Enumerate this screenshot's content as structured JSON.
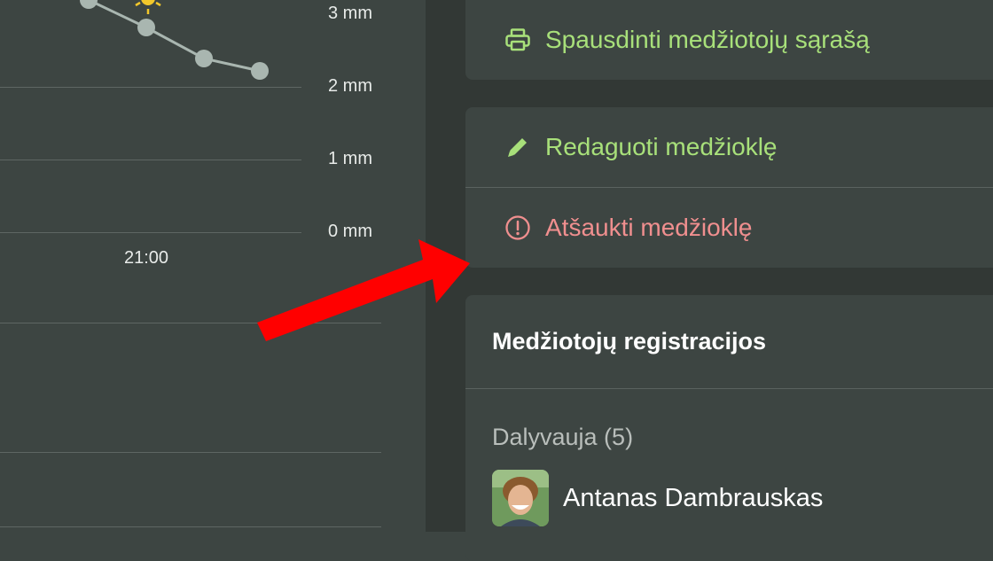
{
  "weather": {
    "y_ticks": [
      "3 mm",
      "2 mm",
      "1 mm",
      "0 mm"
    ],
    "x_tick": "21:00",
    "icons": [
      "sun-icon",
      "moon-icon",
      "moon-icon"
    ]
  },
  "actions": {
    "print_label": "Spausdinti medžiotojų sąrašą",
    "edit_label": "Redaguoti medžioklę",
    "cancel_label": "Atšaukti medžioklę"
  },
  "registrations": {
    "title": "Medžiotojų registracijos",
    "participating": "Dalyvauja (5)",
    "people": [
      {
        "name": "Antanas Dambrauskas"
      }
    ]
  },
  "colors": {
    "accent_green": "#a8e07a",
    "danger_red": "#f08f8f",
    "annotation_arrow": "#ff0000"
  }
}
